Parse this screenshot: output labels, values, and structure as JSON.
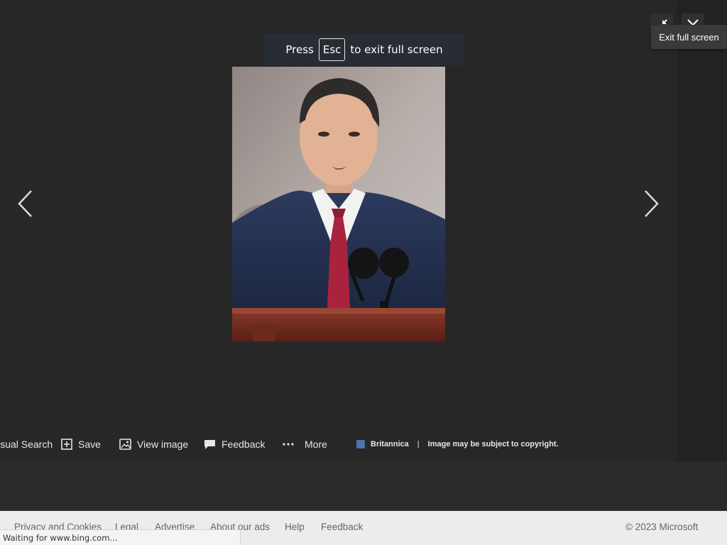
{
  "fullscreen_banner": {
    "press": "Press",
    "key": "Esc",
    "rest": "to exit full screen"
  },
  "tooltip": {
    "exit_fullscreen": "Exit full screen"
  },
  "toolbar": {
    "visual_search": "Visual Search",
    "save": "Save",
    "view_image": "View image",
    "feedback": "Feedback",
    "more": "More"
  },
  "source": {
    "name": "Britannica",
    "separator": "|",
    "copyright": "Image may be subject to copyright."
  },
  "footer": {
    "privacy": "Privacy and Cookies",
    "legal": "Legal",
    "advertise": "Advertise",
    "about_ads": "About our ads",
    "help": "Help",
    "feedback": "Feedback",
    "copyright": "© 2023 Microsoft"
  },
  "status_bar": {
    "text": "Waiting for www.bing.com..."
  },
  "icons": {
    "prev": "chevron-left-icon",
    "next": "chevron-right-icon",
    "exit_fullscreen": "exit-fullscreen-icon",
    "close": "close-icon",
    "save": "save-icon",
    "view_image": "view-image-icon",
    "feedback": "feedback-icon",
    "more": "more-icon",
    "source": "britannica-icon"
  },
  "colors": {
    "background": "#272727",
    "footer_bg": "#ececec"
  }
}
